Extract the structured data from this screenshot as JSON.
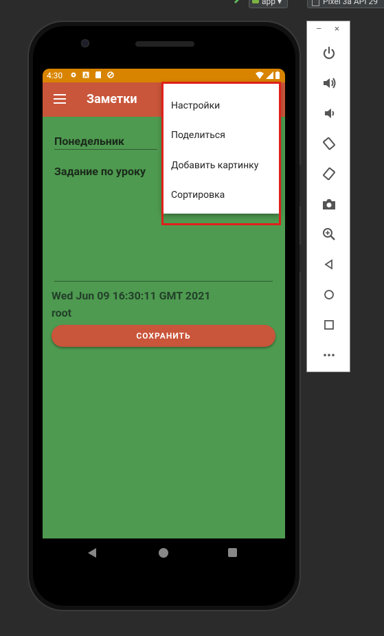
{
  "ide": {
    "run_config": "app",
    "device": "Pixel 3a API 29"
  },
  "statusbar": {
    "time": "4:30"
  },
  "appbar": {
    "title": "Заметки"
  },
  "note": {
    "title": "Понедельник",
    "body": "Задание по уроку",
    "date": "Wed Jun 09 16:30:11 GMT 2021",
    "user": "root"
  },
  "save_button": {
    "label": "СОХРАНИТЬ"
  },
  "overflow_menu": {
    "items": [
      {
        "label": "Настройки"
      },
      {
        "label": "Поделиться"
      },
      {
        "label": "Добавить картинку"
      },
      {
        "label": "Сортировка"
      }
    ]
  },
  "colors": {
    "status_bar": "#d88400",
    "app_bar": "#c9553a",
    "screen_background": "#4e9a50",
    "highlight_border": "#e0201b"
  },
  "emulator_toolbar": {
    "minimize": "–",
    "close": "×",
    "tools": [
      "power-icon",
      "volume-up-icon",
      "volume-down-icon",
      "rotate-left-icon",
      "rotate-right-icon",
      "camera-icon",
      "zoom-icon",
      "back-icon",
      "home-icon",
      "overview-icon",
      "more-icon"
    ]
  }
}
